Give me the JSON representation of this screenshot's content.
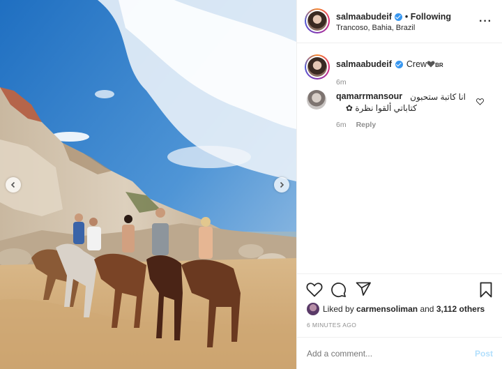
{
  "post": {
    "username": "salmaabudeif",
    "follow_status": "• Following",
    "location": "Trancoso, Bahia, Brazil",
    "more_icon": "more-dots-icon"
  },
  "caption": {
    "username": "salmaabudeif",
    "text": "Crew",
    "suffix": "BR",
    "time": "6m"
  },
  "comment": {
    "username": "qamarrmansour",
    "text_line1": "انا كاتبة ستحبون",
    "text_line2": "كتاباتي ألقوا نظرة",
    "time": "6m",
    "reply_label": "Reply"
  },
  "likes": {
    "prefix": "Liked by",
    "user": "carmensoliman",
    "and": "and",
    "count": "3,112 others"
  },
  "timestamp": "6 MINUTES AGO",
  "add_comment": {
    "placeholder": "Add a comment...",
    "post_label": "Post"
  },
  "colors": {
    "verified": "#3897f0",
    "post_disabled": "#b2dffc",
    "muted": "#8e8e8e"
  }
}
